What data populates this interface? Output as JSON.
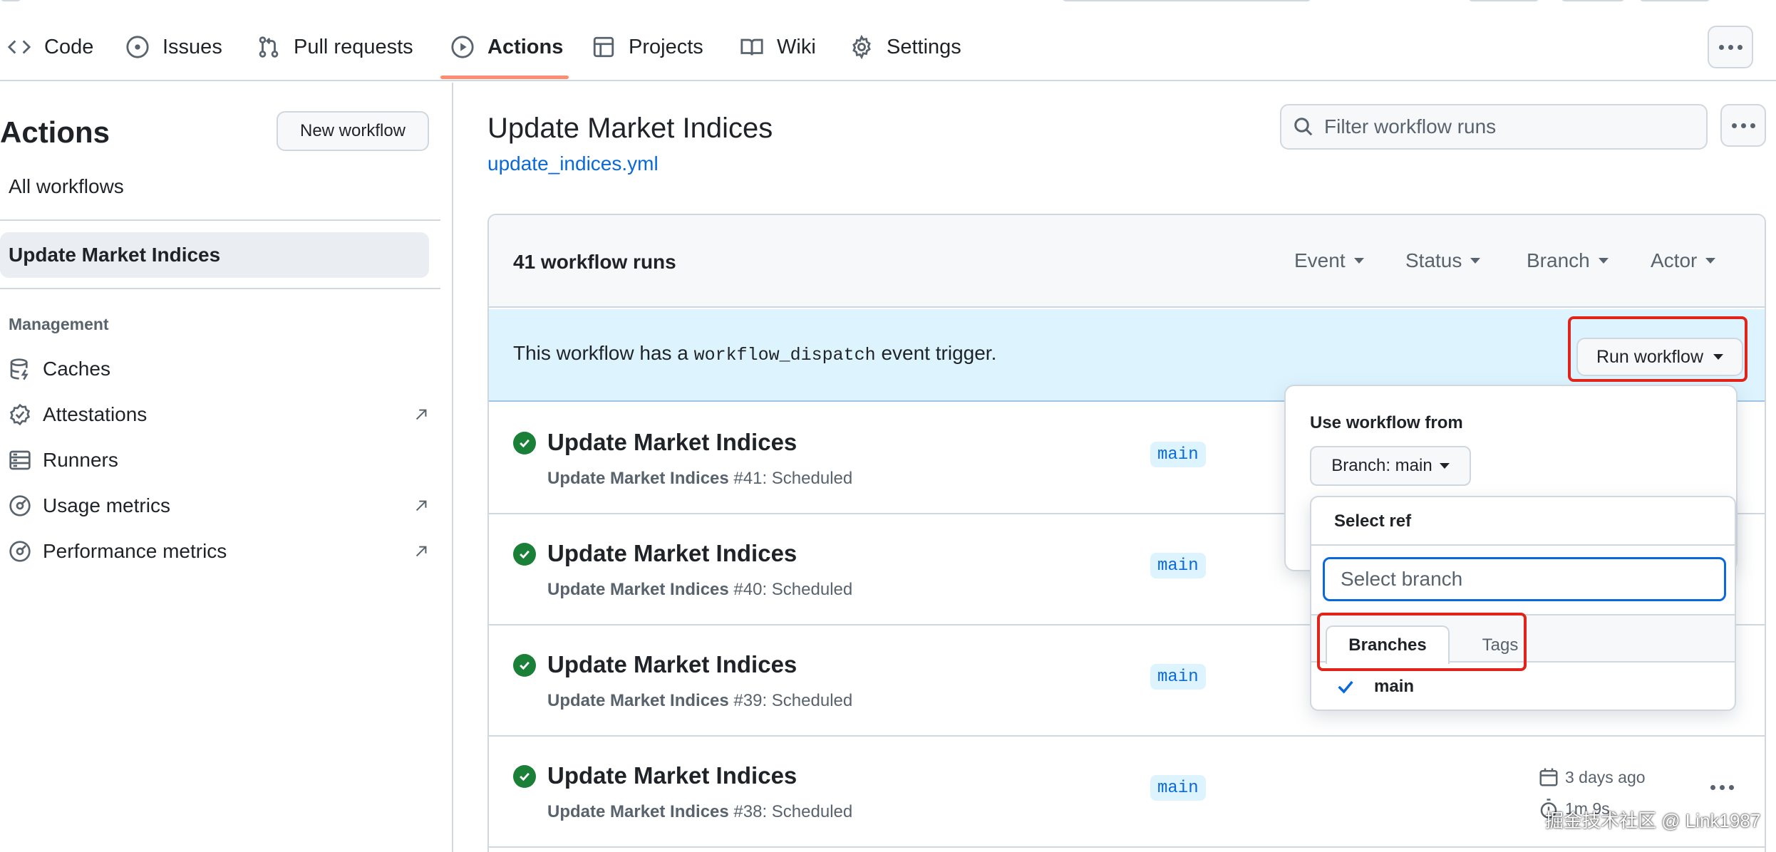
{
  "repo_nav": {
    "tabs": [
      {
        "label": "Code",
        "icon": "code-icon"
      },
      {
        "label": "Issues",
        "icon": "issue-opened-icon"
      },
      {
        "label": "Pull requests",
        "icon": "git-pull-request-icon"
      },
      {
        "label": "Actions",
        "icon": "play-icon",
        "selected": true
      },
      {
        "label": "Projects",
        "icon": "table-icon"
      },
      {
        "label": "Wiki",
        "icon": "book-icon"
      },
      {
        "label": "Settings",
        "icon": "gear-icon"
      }
    ],
    "accent_color": "#fd8c73"
  },
  "sidebar": {
    "title": "Actions",
    "new_workflow_label": "New workflow",
    "all_workflows_label": "All workflows",
    "selected_workflow": "Update Market Indices",
    "management_heading": "Management",
    "management_items": [
      {
        "label": "Caches",
        "icon": "database-icon"
      },
      {
        "label": "Attestations",
        "icon": "verified-icon",
        "external": true
      },
      {
        "label": "Runners",
        "icon": "server-icon"
      },
      {
        "label": "Usage metrics",
        "icon": "meter-icon",
        "external": true
      },
      {
        "label": "Performance metrics",
        "icon": "meter-icon",
        "external": true
      }
    ]
  },
  "main": {
    "title": "Update Market Indices",
    "workflow_file": "update_indices.yml",
    "filter_placeholder": "Filter workflow runs",
    "runs_count": "41 workflow runs",
    "filters": [
      "Event",
      "Status",
      "Branch",
      "Actor"
    ],
    "dispatch": {
      "text_before": "This workflow has a ",
      "code": "workflow_dispatch",
      "text_after": " event trigger.",
      "button_label": "Run workflow"
    },
    "runs": [
      {
        "title": "Update Market Indices",
        "workflow": "Update Market Indices",
        "detail": " #41: Scheduled",
        "branch": "main"
      },
      {
        "title": "Update Market Indices",
        "workflow": "Update Market Indices",
        "detail": " #40: Scheduled",
        "branch": "main"
      },
      {
        "title": "Update Market Indices",
        "workflow": "Update Market Indices",
        "detail": " #39: Scheduled",
        "branch": "main"
      },
      {
        "title": "Update Market Indices",
        "workflow": "Update Market Indices",
        "detail": " #38: Scheduled",
        "branch": "main",
        "date": "3 days ago",
        "duration": "1m 9s"
      }
    ],
    "success_color": "#1a7f37"
  },
  "dropdown": {
    "label": "Use workflow from",
    "branch_button": "Branch: main",
    "select_ref": {
      "title": "Select ref",
      "placeholder": "Select branch",
      "tabs": [
        "Branches",
        "Tags"
      ],
      "items": [
        "main"
      ]
    }
  },
  "annotation_color": "#e0241a",
  "watermark": "掘金技术社区 @ Link1987"
}
